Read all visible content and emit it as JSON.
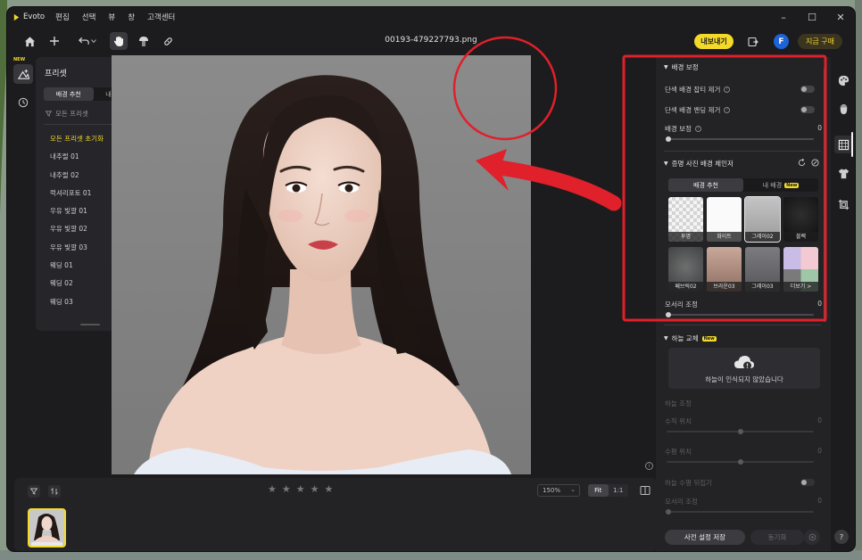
{
  "app": {
    "name": "Evoto",
    "menu": [
      "편집",
      "선택",
      "뷰",
      "창",
      "고객센터"
    ],
    "filename": "00193-479227793.png",
    "export_label": "내보내기",
    "profile_initial": "F",
    "buy_label": "지금 구매"
  },
  "preset_panel": {
    "new_badge": "NEW",
    "title": "프리셋",
    "tabs": [
      "배경 추천",
      "내 프리셋"
    ],
    "filter_label": "모든 프리셋",
    "items": [
      "모든 프리셋 초기화",
      "내추럴 01",
      "내추럴 02",
      "럭셔리포토 01",
      "우유 빛깔 01",
      "우유 빛깔 02",
      "우유 빛깔 03",
      "웨딩 01",
      "웨딩 02",
      "웨딩 03"
    ]
  },
  "bottom": {
    "rating": 0,
    "zoom_value": "150%",
    "fit_label": "Fit",
    "one_to_one_label": "1:1"
  },
  "right_panel": {
    "bg_adjust": {
      "title": "배경 보정",
      "remove_stains_label": "단색 배경 잡티 제거",
      "remove_banding_label": "단색 배경 밴딩 제거",
      "bg_correction_label": "배경 보정",
      "bg_correction_value": "0"
    },
    "id_photo": {
      "title": "증명 사진 배경 체인저",
      "tabs": [
        "배경 추천",
        "내 배경"
      ],
      "tab_new": "New",
      "tiles": [
        "투명",
        "화이트",
        "그레이02",
        "블랙",
        "페브릭02",
        "브라운03",
        "그레이03",
        "더보기 >"
      ],
      "edge_label": "모서리 조정",
      "edge_value": "0"
    },
    "sky": {
      "title": "하늘 교체",
      "new_tag": "New",
      "message": "하늘이 인식되지 않았습니다",
      "adjust_label": "하늘 조정",
      "vertical_label": "수직 위치",
      "vertical_value": "0",
      "horizontal_label": "수평 위치",
      "horizontal_value": "0",
      "flip_label": "하늘 수평 뒤집기",
      "edge_label": "모서리 조정",
      "edge_value": "0"
    },
    "save_label": "사전 설정 저장",
    "sync_label": "동기화"
  },
  "rail": {
    "help": "?"
  },
  "colors": {
    "accent": "#f3d92a",
    "annotation": "#e0202a",
    "panel": "#26262a"
  }
}
